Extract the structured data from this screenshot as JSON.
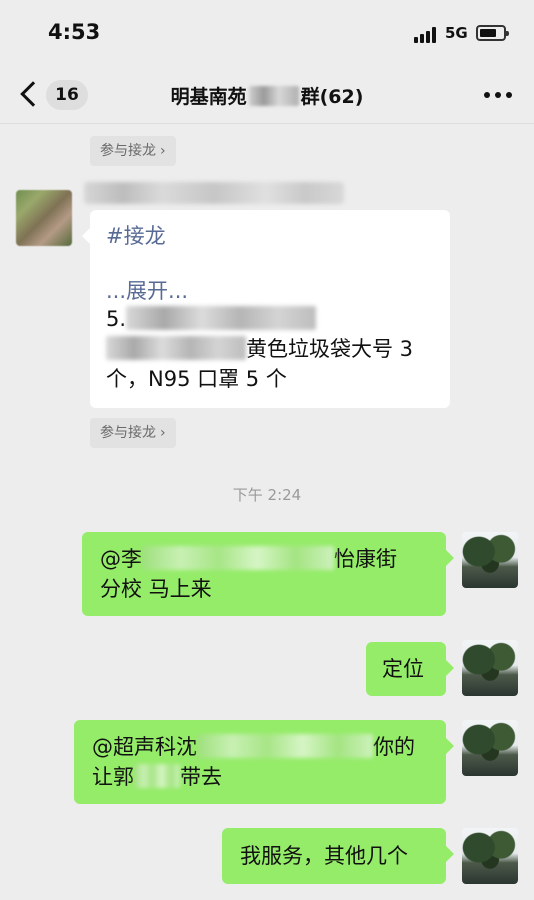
{
  "status_bar": {
    "time": "4:53",
    "network": "5G"
  },
  "nav": {
    "badge": "16",
    "title_prefix": "明基南苑",
    "title_suffix": "群(62)"
  },
  "join_pill": {
    "label": "参与接龙",
    "arrow": "›"
  },
  "jielong_message": {
    "tag": "#接龙",
    "expand": "...展开...",
    "item_no": "5.",
    "line2_text": "黄色垃圾袋大号 3",
    "line3_text": "个，N95 口罩 5 个"
  },
  "timestamp": "下午 2:24",
  "messages": {
    "m1": {
      "prefix": "@李",
      "line1_tail": "怡康街",
      "line2": "分校 马上来"
    },
    "m2": {
      "text": "定位"
    },
    "m3": {
      "prefix": "@超声科沈",
      "line1_tail": "你的",
      "line2_head": "让郭",
      "line2_tail": "带去"
    },
    "m4": {
      "text": "我服务，其他几个"
    }
  }
}
